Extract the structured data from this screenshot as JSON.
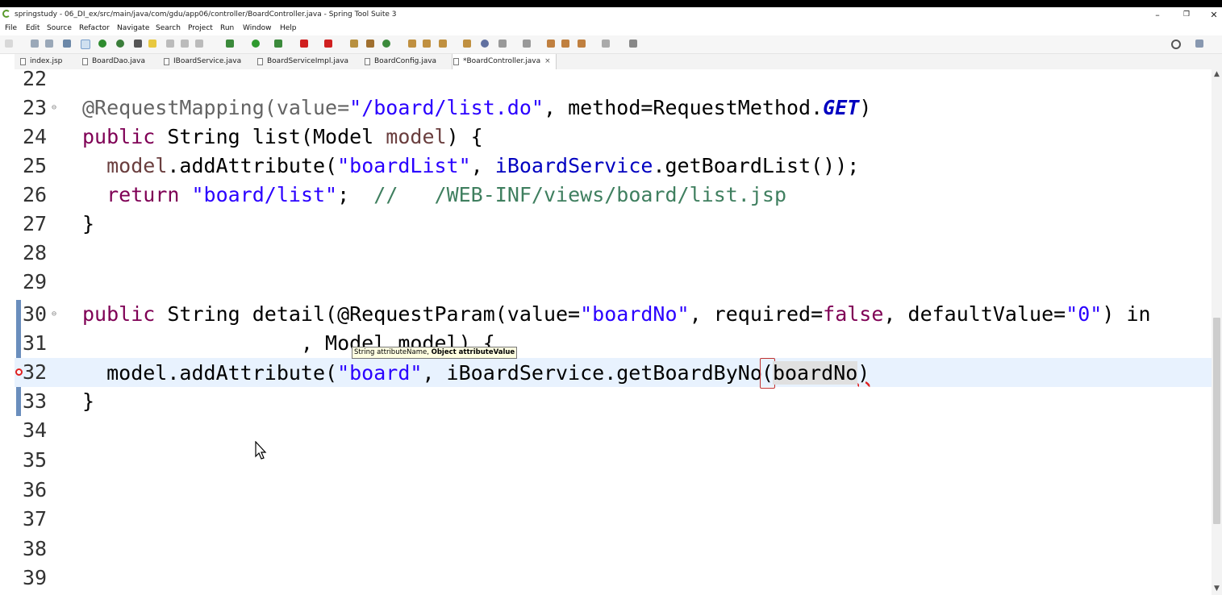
{
  "window": {
    "title": "springstudy - 06_DI_ex/src/main/java/com/gdu/app06/controller/BoardController.java - Spring Tool Suite 3",
    "minimize": "–",
    "restore": "❐",
    "close": "✕"
  },
  "menu": [
    "File",
    "Edit",
    "Source",
    "Refactor",
    "Navigate",
    "Search",
    "Project",
    "Run",
    "Window",
    "Help"
  ],
  "tabs": [
    {
      "label": "index.jsp"
    },
    {
      "label": "BoardDao.java"
    },
    {
      "label": "IBoardService.java"
    },
    {
      "label": "BoardServiceImpl.java"
    },
    {
      "label": "BoardConfig.java"
    },
    {
      "label": "*BoardController.java",
      "active": true
    }
  ],
  "tab_close": "×",
  "lines": [
    {
      "n": "22"
    },
    {
      "n": "23"
    },
    {
      "n": "24"
    },
    {
      "n": "25"
    },
    {
      "n": "26"
    },
    {
      "n": "27"
    },
    {
      "n": "28"
    },
    {
      "n": "29"
    },
    {
      "n": "30"
    },
    {
      "n": "31"
    },
    {
      "n": "32"
    },
    {
      "n": "33"
    },
    {
      "n": "34"
    },
    {
      "n": "35"
    },
    {
      "n": "36"
    },
    {
      "n": "37"
    },
    {
      "n": "38"
    },
    {
      "n": "39"
    }
  ],
  "code": {
    "l23_a": "@RequestMapping(value=",
    "l23_b": "\"/board/list.do\"",
    "l23_c": ", method=RequestMethod.",
    "l23_d": "GET",
    "l23_e": ")",
    "l24_a": "public",
    "l24_b": " String list(Model ",
    "l24_c": "model",
    "l24_d": ") {",
    "l25_a": "  ",
    "l25_b": "model",
    "l25_c": ".addAttribute(",
    "l25_d": "\"boardList\"",
    "l25_e": ", ",
    "l25_f": "iBoardService",
    "l25_g": ".getBoardList());",
    "l26_a": "  ",
    "l26_b": "return",
    "l26_c": " ",
    "l26_d": "\"board/list\"",
    "l26_e": ";  ",
    "l26_f": "//   /WEB-INF/views/board/list.jsp",
    "l27": "}",
    "l30_a": "public",
    "l30_b": " String detail(@RequestParam(value=",
    "l30_c": "\"boardNo\"",
    "l30_d": ", required=",
    "l30_e": "false",
    "l30_f": ", defaultValue=",
    "l30_g": "\"0\"",
    "l30_h": ") in",
    "l31": "                  , Model model) {",
    "l32_a": "  model.addAttribute(",
    "l32_b": "\"board\"",
    "l32_c": ", iBoardService.getBoardByNo",
    "l32_d": "(",
    "l32_e": "boardNo",
    "l32_f": ")",
    "l33": "}"
  },
  "tooltip": {
    "normal": "String attributeName, ",
    "bold": "Object attributeValue"
  },
  "colors": {
    "keyword": "#7f0055",
    "string": "#2a00ff",
    "comment": "#3f7f5f",
    "field": "#0000c0",
    "current_line": "#e8f2fe"
  }
}
